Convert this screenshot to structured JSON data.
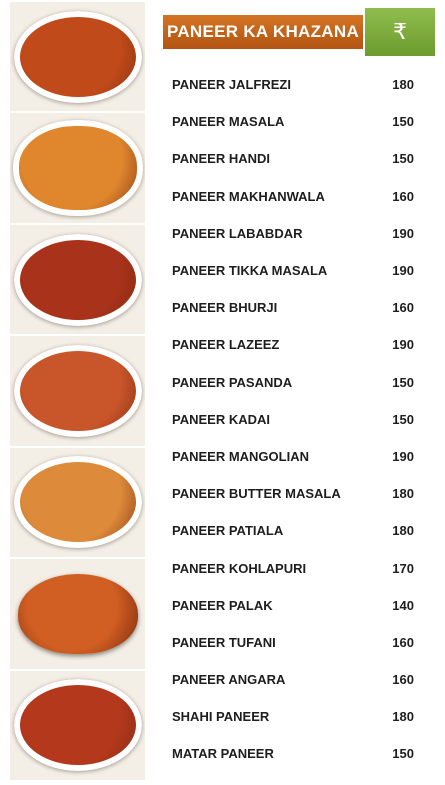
{
  "header": {
    "title": "PANEER KA KHAZANA",
    "currency_symbol": "₹",
    "title_bg": "#c3621a",
    "currency_bg": "#7fad3e"
  },
  "menu": [
    {
      "name": "PANEER JALFREZI",
      "price": "180"
    },
    {
      "name": "PANEER MASALA",
      "price": "150"
    },
    {
      "name": "PANEER HANDI",
      "price": "150"
    },
    {
      "name": "PANEER MAKHANWALA",
      "price": "160"
    },
    {
      "name": "PANEER LABABDAR",
      "price": "190"
    },
    {
      "name": "PANEER TIKKA MASALA",
      "price": "190"
    },
    {
      "name": "PANEER BHURJI",
      "price": "160"
    },
    {
      "name": "PANEER LAZEEZ",
      "price": "190"
    },
    {
      "name": "PANEER PASANDA",
      "price": "150"
    },
    {
      "name": "PANEER KADAI",
      "price": "150"
    },
    {
      "name": "PANEER MANGOLIAN",
      "price": "190"
    },
    {
      "name": "PANEER BUTTER MASALA",
      "price": "180"
    },
    {
      "name": "PANEER PATIALA",
      "price": "180"
    },
    {
      "name": "PANEER KOHLAPURI",
      "price": "170"
    },
    {
      "name": "PANEER PALAK",
      "price": "140"
    },
    {
      "name": "PANEER TUFANI",
      "price": "160"
    },
    {
      "name": "PANEER ANGARA",
      "price": "160"
    },
    {
      "name": "SHAHI PANEER",
      "price": "180"
    },
    {
      "name": "MATAR PANEER",
      "price": "150"
    }
  ],
  "photos": [
    {
      "icon": "stir-fried-paneer-photo",
      "color": "#c04a1a"
    },
    {
      "icon": "paneer-masala-triangles-photo",
      "color": "#e0872e"
    },
    {
      "icon": "chilli-paneer-photo",
      "color": "#a8321a"
    },
    {
      "icon": "kadai-paneer-photo",
      "color": "#c9552a"
    },
    {
      "icon": "paneer-curry-bowl-photo",
      "color": "#dd8a3a"
    },
    {
      "icon": "paneer-curry-copper-bowl-photo",
      "color": "#d15e22"
    },
    {
      "icon": "paneer-with-onion-rings-photo",
      "color": "#b3381c"
    }
  ]
}
